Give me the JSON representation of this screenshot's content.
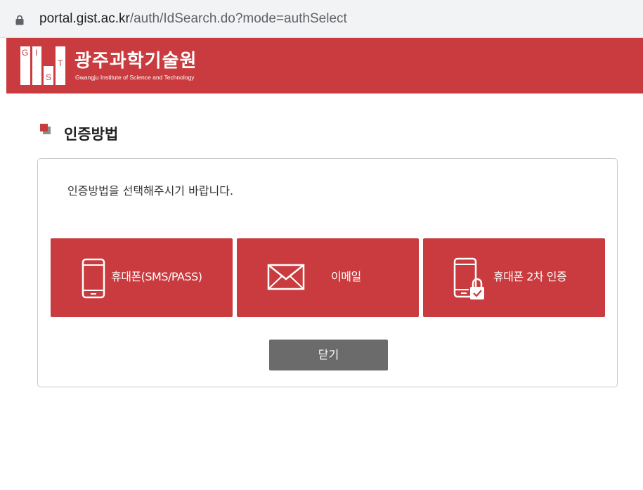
{
  "browser": {
    "url_host": "portal.gist.ac.kr",
    "url_path": "/auth/IdSearch.do?mode=authSelect",
    "lock_icon": "lock-icon"
  },
  "header": {
    "logo_letters": [
      "G",
      "I",
      "S",
      "T"
    ],
    "institution_ko": "광주과학기술원",
    "institution_en": "Gwangju Institute of Science and Technology",
    "brand_color": "#c93b3e"
  },
  "page": {
    "title": "인증방법"
  },
  "panel": {
    "instruction": "인증방법을 선택해주시기 바랍니다.",
    "methods": [
      {
        "label": "휴대폰(SMS/PASS)",
        "icon": "smartphone-icon"
      },
      {
        "label": "이메일",
        "icon": "envelope-icon"
      },
      {
        "label": "휴대폰 2차 인증",
        "icon": "smartphone-lock-icon"
      }
    ],
    "close_label": "닫기",
    "close_color": "#6b6b6b"
  }
}
